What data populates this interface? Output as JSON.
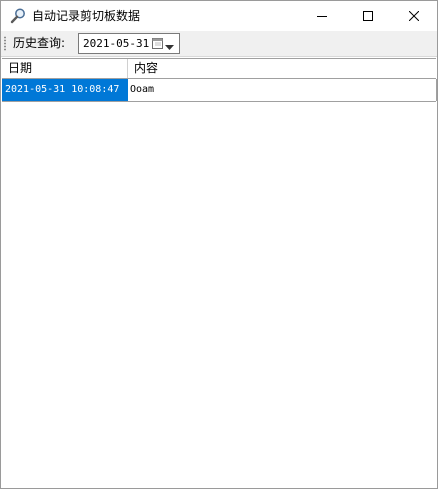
{
  "window": {
    "title": "自动记录剪切板数据"
  },
  "toolbar": {
    "history_label": "历史查询:",
    "date_value": "2021-05-31"
  },
  "grid": {
    "columns": [
      "日期",
      "内容"
    ],
    "rows": [
      {
        "date": "2021-05-31 10:08:47",
        "content": "Ooam"
      }
    ]
  },
  "colors": {
    "selection": "#0078d7",
    "toolbar_bg": "#f0f0f0"
  },
  "icons": {
    "app": "magnifier-icon",
    "minimize": "minimize-icon",
    "maximize": "maximize-icon",
    "close": "close-icon",
    "calendar": "calendar-icon",
    "dropdown": "dropdown-arrow-icon"
  }
}
